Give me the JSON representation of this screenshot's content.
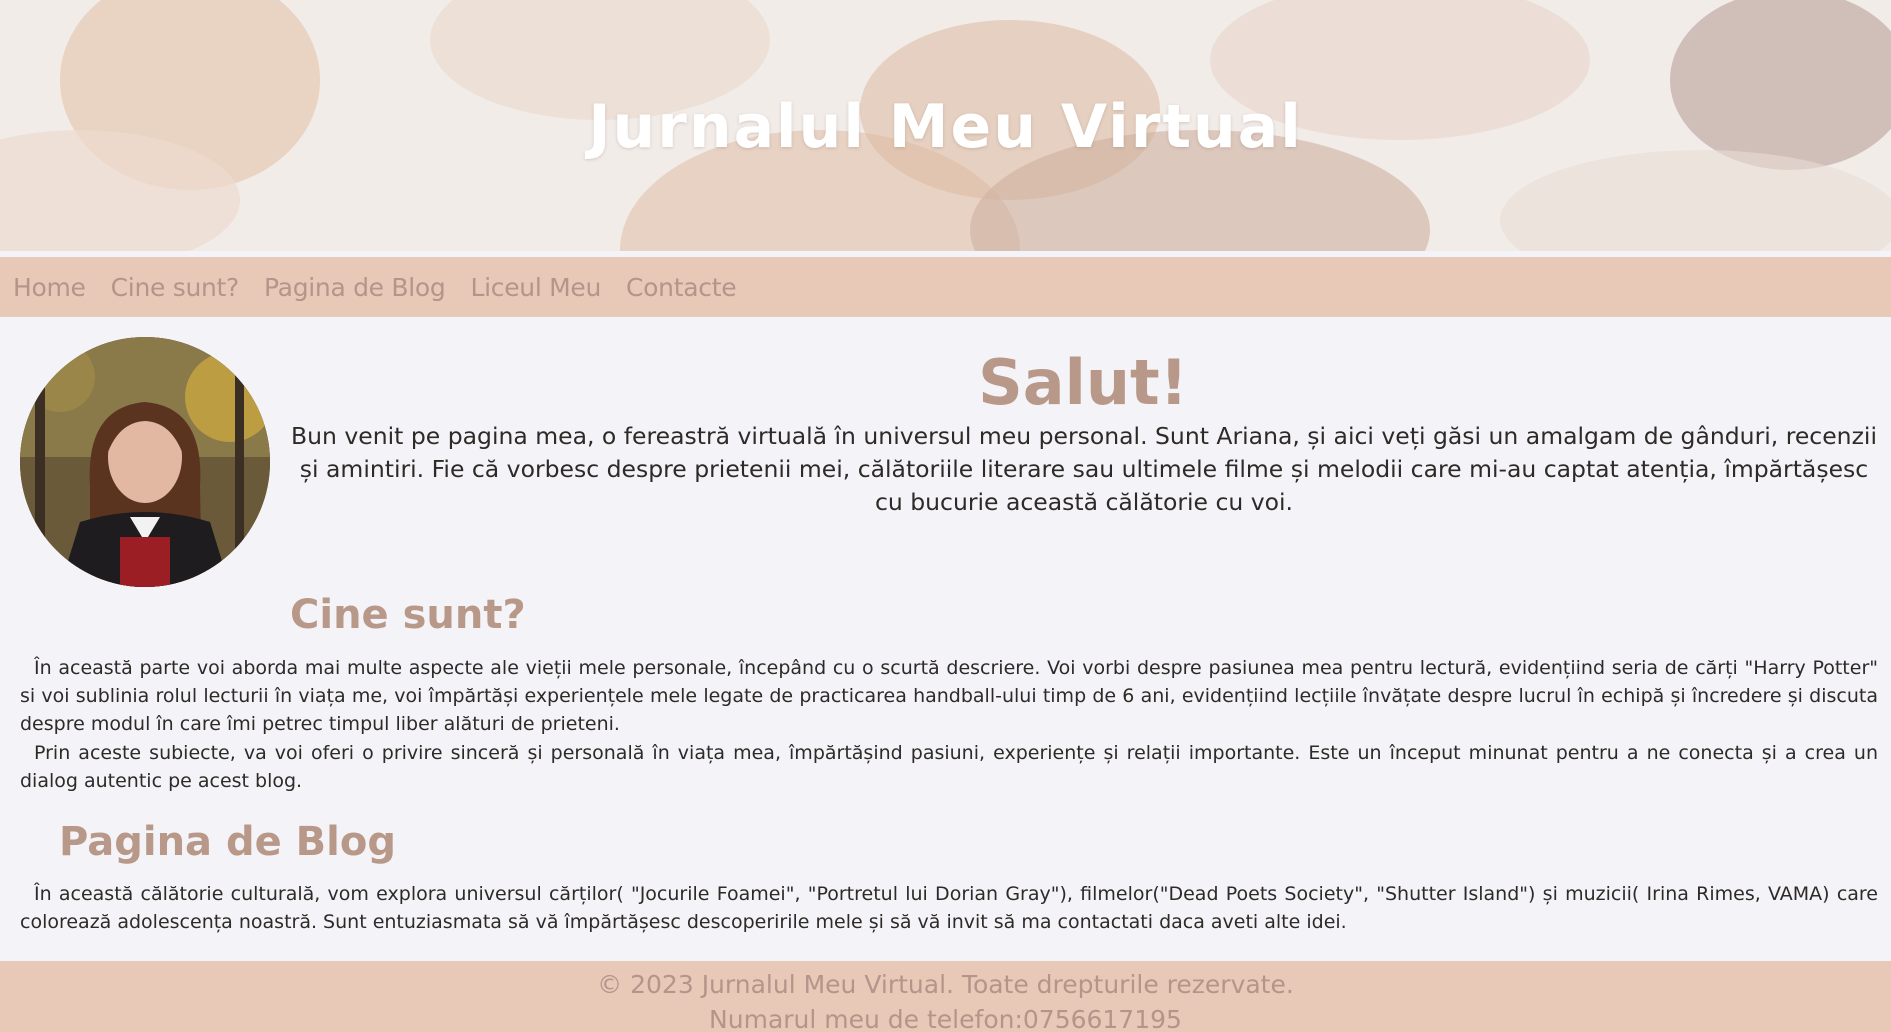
{
  "header": {
    "title": "Jurnalul Meu Virtual"
  },
  "nav": {
    "items": [
      "Home",
      "Cine sunt?",
      "Pagina de Blog",
      "Liceul Meu",
      "Contacte"
    ]
  },
  "welcome": {
    "heading": "Salut!",
    "text": "Bun venit pe pagina mea, o fereastră virtuală în universul meu personal. Sunt Ariana, și aici veți găsi un amalgam de gânduri, recenzii și amintiri. Fie că vorbesc despre prietenii mei, călătoriile literare sau ultimele filme și melodii care mi-au captat atenția, împărtășesc cu bucurie această călătorie cu voi."
  },
  "about": {
    "heading": "Cine sunt?",
    "paragraph1": "În această parte voi aborda mai multe aspecte ale vieții mele personale, începând cu o scurtă descriere. Voi vorbi despre pasiunea mea pentru lectură, evidențiind seria de cărți \"Harry Potter\" si voi sublinia rolul lecturii în viața me, voi împărtăși experiențele mele legate de practicarea handball-ului timp de 6 ani, evidențiind lecțiile învățate despre lucrul în echipă și încredere și discuta despre modul în care îmi petrec timpul liber alături de prieteni.",
    "paragraph2": "Prin aceste subiecte, va voi oferi o privire sinceră și personală în viața mea, împărtășind pasiuni, experiențe și relații importante. Este un început minunat pentru a ne conecta și a crea un dialog autentic pe acest blog."
  },
  "blog": {
    "heading": "Pagina de Blog",
    "paragraph": "În această călătorie culturală, vom explora universul cărților( \"Jocurile Foamei\", \"Portretul lui Dorian Gray\"), filmelor(\"Dead Poets Society\", \"Shutter Island\") și muzicii( Irina Rimes, VAMA) care colorează adolescența noastră. Sunt entuziasmata să vă împărtășesc descoperirile mele și să vă invit să ma contactati daca aveti alte idei."
  },
  "footer": {
    "copyright": "© 2023 Jurnalul Meu Virtual. Toate drepturile rezervate.",
    "phone": "Numarul meu de telefon:0756617195"
  },
  "colors": {
    "accent": "#b89889",
    "nav_background": "#e8c9b7",
    "page_background": "#f4f3f7"
  }
}
